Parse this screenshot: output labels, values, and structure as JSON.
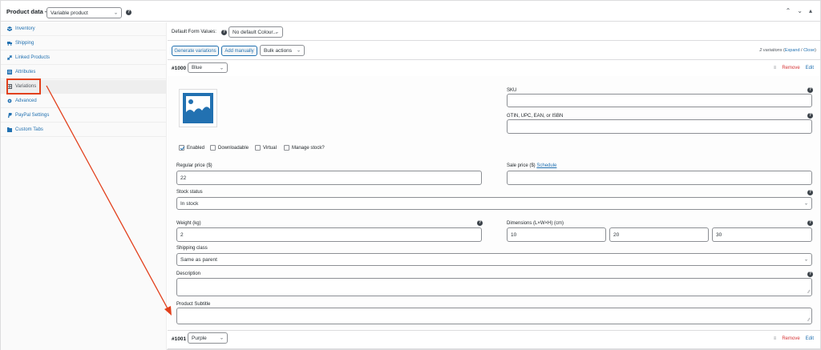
{
  "header": {
    "title": "Product data —",
    "product_type": "Variable product",
    "help": "?",
    "icons": [
      "chevron-up-icon",
      "chevron-down-icon",
      "collapse-toggle-icon"
    ]
  },
  "sidebar": {
    "items": [
      {
        "label": "Inventory",
        "icon": "inventory-icon"
      },
      {
        "label": "Shipping",
        "icon": "truck-icon"
      },
      {
        "label": "Linked Products",
        "icon": "link-icon"
      },
      {
        "label": "Attributes",
        "icon": "list-icon"
      },
      {
        "label": "Variations",
        "icon": "grid-icon"
      },
      {
        "label": "Advanced",
        "icon": "gear-icon"
      },
      {
        "label": "PayPal Settings",
        "icon": "paypal-icon"
      },
      {
        "label": "Custom Tabs",
        "icon": "tabs-icon"
      }
    ],
    "active_index": 4
  },
  "defaults": {
    "label": "Default Form Values:",
    "select": "No default Colour..."
  },
  "toolbar": {
    "generate": "Generate variations",
    "add_manually": "Add manually",
    "bulk_actions": "Bulk actions",
    "count_text": "2 variations",
    "expand": "Expand",
    "slash": " / ",
    "close": "Close"
  },
  "variation1": {
    "id": "#1000",
    "attribute": "Blue",
    "remove": "Remove",
    "edit": "Edit",
    "sku_label": "SKU",
    "gtin_label": "GTIN, UPC, EAN, or ISBN",
    "enabled": "Enabled",
    "downloadable": "Downloadable",
    "virtual": "Virtual",
    "manage_stock": "Manage stock?",
    "regular_price_label": "Regular price ($)",
    "regular_price": "22",
    "sale_price_label": "Sale price ($)",
    "schedule": "Schedule",
    "stock_status_label": "Stock status",
    "stock_status": "In stock",
    "weight_label": "Weight (kg)",
    "weight": "2",
    "dimensions_label": "Dimensions (L×W×H) (cm)",
    "length": "10",
    "width": "20",
    "height": "30",
    "shipping_class_label": "Shipping class",
    "shipping_class": "Same as parent",
    "description_label": "Description",
    "subtitle_label": "Product Subtitle"
  },
  "variation2": {
    "id": "#1001",
    "attribute": "Purple",
    "remove": "Remove",
    "edit": "Edit"
  },
  "colors": {
    "accent": "#2271b1",
    "remove": "#d63638",
    "annotation": "#e2401c"
  }
}
